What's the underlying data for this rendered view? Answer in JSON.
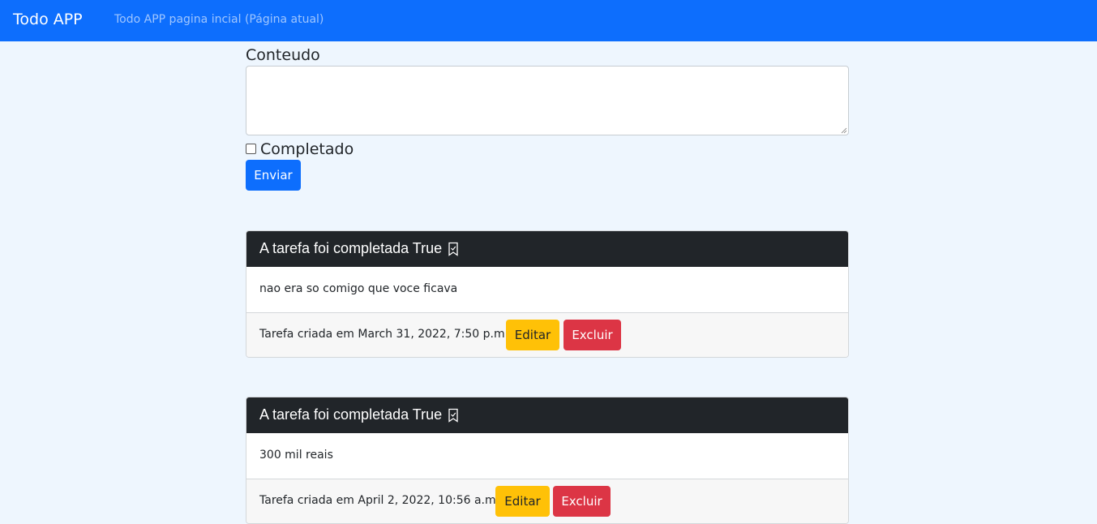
{
  "navbar": {
    "brand": "Todo APP",
    "link": "Todo APP pagina incial (Página atual)"
  },
  "form": {
    "content_label": "Conteudo",
    "content_value": "",
    "completed_label": "Completado",
    "completed_checked": false,
    "submit_label": "Enviar"
  },
  "tasks": [
    {
      "title": "A tarefa foi completada True",
      "content": "nao era so comigo que voce ficava",
      "created": "Tarefa criada em March 31, 2022, 7:50 p.m.",
      "edit_label": "Editar",
      "delete_label": "Excluir",
      "icon": "bookmark-check-icon"
    },
    {
      "title": "A tarefa foi completada True",
      "content": "300 mil reais",
      "created": "Tarefa criada em April 2, 2022, 10:56 a.m.",
      "edit_label": "Editar",
      "delete_label": "Excluir",
      "icon": "bookmark-check-icon"
    }
  ],
  "colors": {
    "primary": "#0d6efd",
    "warning": "#ffc107",
    "danger": "#dc3545",
    "card_header": "#212529",
    "page_background": "#eef6fe"
  }
}
